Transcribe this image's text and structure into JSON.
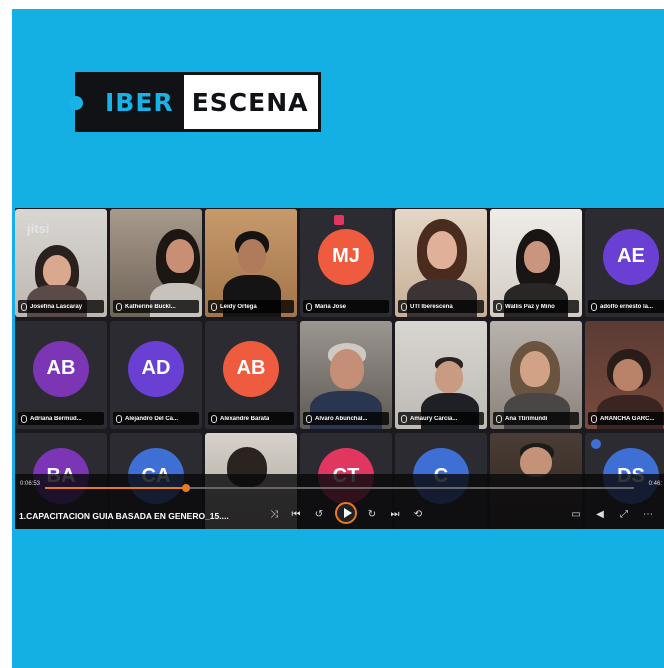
{
  "brand": {
    "part1": "IBER",
    "part2": "ESCENA",
    "dark_color": "#101216",
    "accent": "#17b2e6"
  },
  "watermark": "jitsi",
  "row1": [
    {
      "name": "Josefina Lascaray"
    },
    {
      "name": "Katherine Buckl..."
    },
    {
      "name": "Leidy Ortega"
    },
    {
      "name": "Maria Jose",
      "initials": "MJ",
      "color": "#ee5b3e"
    },
    {
      "name": "UTI Iberescena"
    },
    {
      "name": "Wallis Paz y Miño"
    },
    {
      "name": "adolfo ernesto la...",
      "initials": "AE",
      "color": "#6a3fd3"
    }
  ],
  "row2": [
    {
      "name": "Adriana Bermúd...",
      "initials": "AB",
      "color": "#7b35b5"
    },
    {
      "name": "Alejandro Del Ca...",
      "initials": "AD",
      "color": "#6a3fd3"
    },
    {
      "name": "Alexandre Barata",
      "initials": "AB",
      "color": "#ee5b3e"
    },
    {
      "name": "Alvaro Abunchal..."
    },
    {
      "name": "Amaury Carcia..."
    },
    {
      "name": "Ana Ttirimundi"
    },
    {
      "name": "ARANCHA GARC..."
    }
  ],
  "row3": [
    {
      "initials": "BA",
      "color": "#7b35b5"
    },
    {
      "initials": "CA",
      "color": "#3d6fd4"
    },
    {
      "initials": ""
    },
    {
      "initials": "CT",
      "color": "#e0365f"
    },
    {
      "initials": "C",
      "color": "#3d6fd4"
    },
    {
      "initials": ""
    },
    {
      "initials": "DS",
      "color": "#3d6fd4"
    }
  ],
  "player": {
    "file_title": "1.CAPACITACION GUIA BASADA EN GENERO_15....",
    "time_current": "0:06:53",
    "time_end": "0:46:",
    "progress": 0.24,
    "accent": "#e77b22"
  },
  "icons": {
    "shuffle": "⤨",
    "prev": "⏮",
    "rewind": "↺",
    "forward": "↻",
    "next": "⏭",
    "repeat": "⟲",
    "cast": "▭",
    "volume": "◀",
    "fullscreen": "⤢",
    "more": "⋯"
  }
}
